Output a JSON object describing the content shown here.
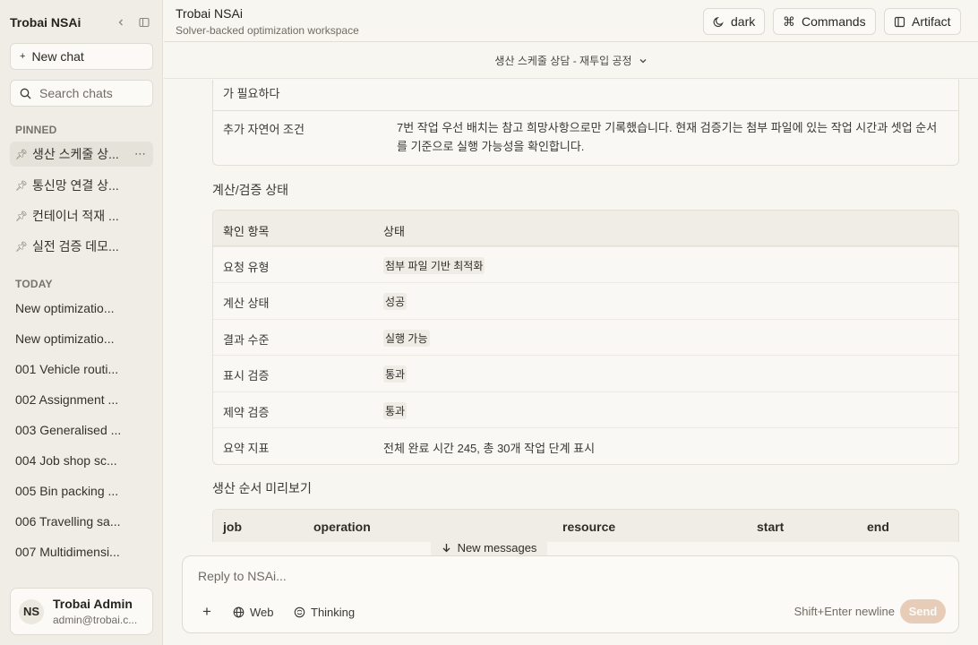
{
  "sidebar": {
    "title": "Trobai NSAi",
    "new_chat": "New chat",
    "search_placeholder": "Search chats",
    "pinned_label": "PINNED",
    "pinned": [
      {
        "label": "생산 스케줄 상..."
      },
      {
        "label": "통신망 연결 상..."
      },
      {
        "label": "컨테이너 적재 ..."
      },
      {
        "label": "실전 검증 데모..."
      }
    ],
    "today_label": "TODAY",
    "today": [
      {
        "label": "New optimizatio..."
      },
      {
        "label": "New optimizatio..."
      },
      {
        "label": "001 Vehicle routi..."
      },
      {
        "label": "002 Assignment ..."
      },
      {
        "label": "003 Generalised ..."
      },
      {
        "label": "004 Job shop sc..."
      },
      {
        "label": "005 Bin packing ..."
      },
      {
        "label": "006 Travelling sa..."
      },
      {
        "label": "007 Multidimensi..."
      }
    ],
    "user": {
      "initials": "NS",
      "name": "Trobai Admin",
      "email": "admin@trobai.c..."
    }
  },
  "header": {
    "title": "Trobai NSAi",
    "subtitle": "Solver-backed optimization workspace",
    "theme_btn": "dark",
    "commands_btn": "Commands",
    "artifact_btn": "Artifact"
  },
  "thread": {
    "title": "생산 스케줄 상담 - 재투입 공정"
  },
  "content": {
    "partial_text": "가 필요하다",
    "extra_key": "추가 자연어 조건",
    "extra_value": "7번 작업 우선 배치는 참고 희망사항으로만 기록했습니다. 현재 검증기는 첨부 파일에 있는 작업 시간과 셋업 순서를 기준으로 실행 가능성을 확인합니다.",
    "status_section": "계산/검증 상태",
    "status_headers": {
      "item": "확인 항목",
      "state": "상태"
    },
    "status_rows": [
      {
        "key": "요청 유형",
        "value": "첨부 파일 기반 최적화",
        "chip": true
      },
      {
        "key": "계산 상태",
        "value": "성공",
        "chip": true
      },
      {
        "key": "결과 수준",
        "value": "실행 가능",
        "chip": true
      },
      {
        "key": "표시 검증",
        "value": "통과",
        "chip": true
      },
      {
        "key": "제약 검증",
        "value": "통과",
        "chip": true
      },
      {
        "key": "요약 지표",
        "value": "전체 완료 시간 245, 총 30개 작업 단계 표시",
        "chip": false
      }
    ],
    "preview_section": "생산 순서 미리보기",
    "preview_headers": {
      "job": "job",
      "operation": "operation",
      "resource": "resource",
      "start": "start",
      "end": "end"
    }
  },
  "new_messages": "New messages",
  "composer": {
    "placeholder": "Reply to NSAi...",
    "web": "Web",
    "thinking": "Thinking",
    "hint": "Shift+Enter newline",
    "send": "Send"
  },
  "colors": {
    "accent_send": "#e7cdb7",
    "sidebar_bg": "#efede6",
    "main_bg": "#f7f6f1"
  }
}
